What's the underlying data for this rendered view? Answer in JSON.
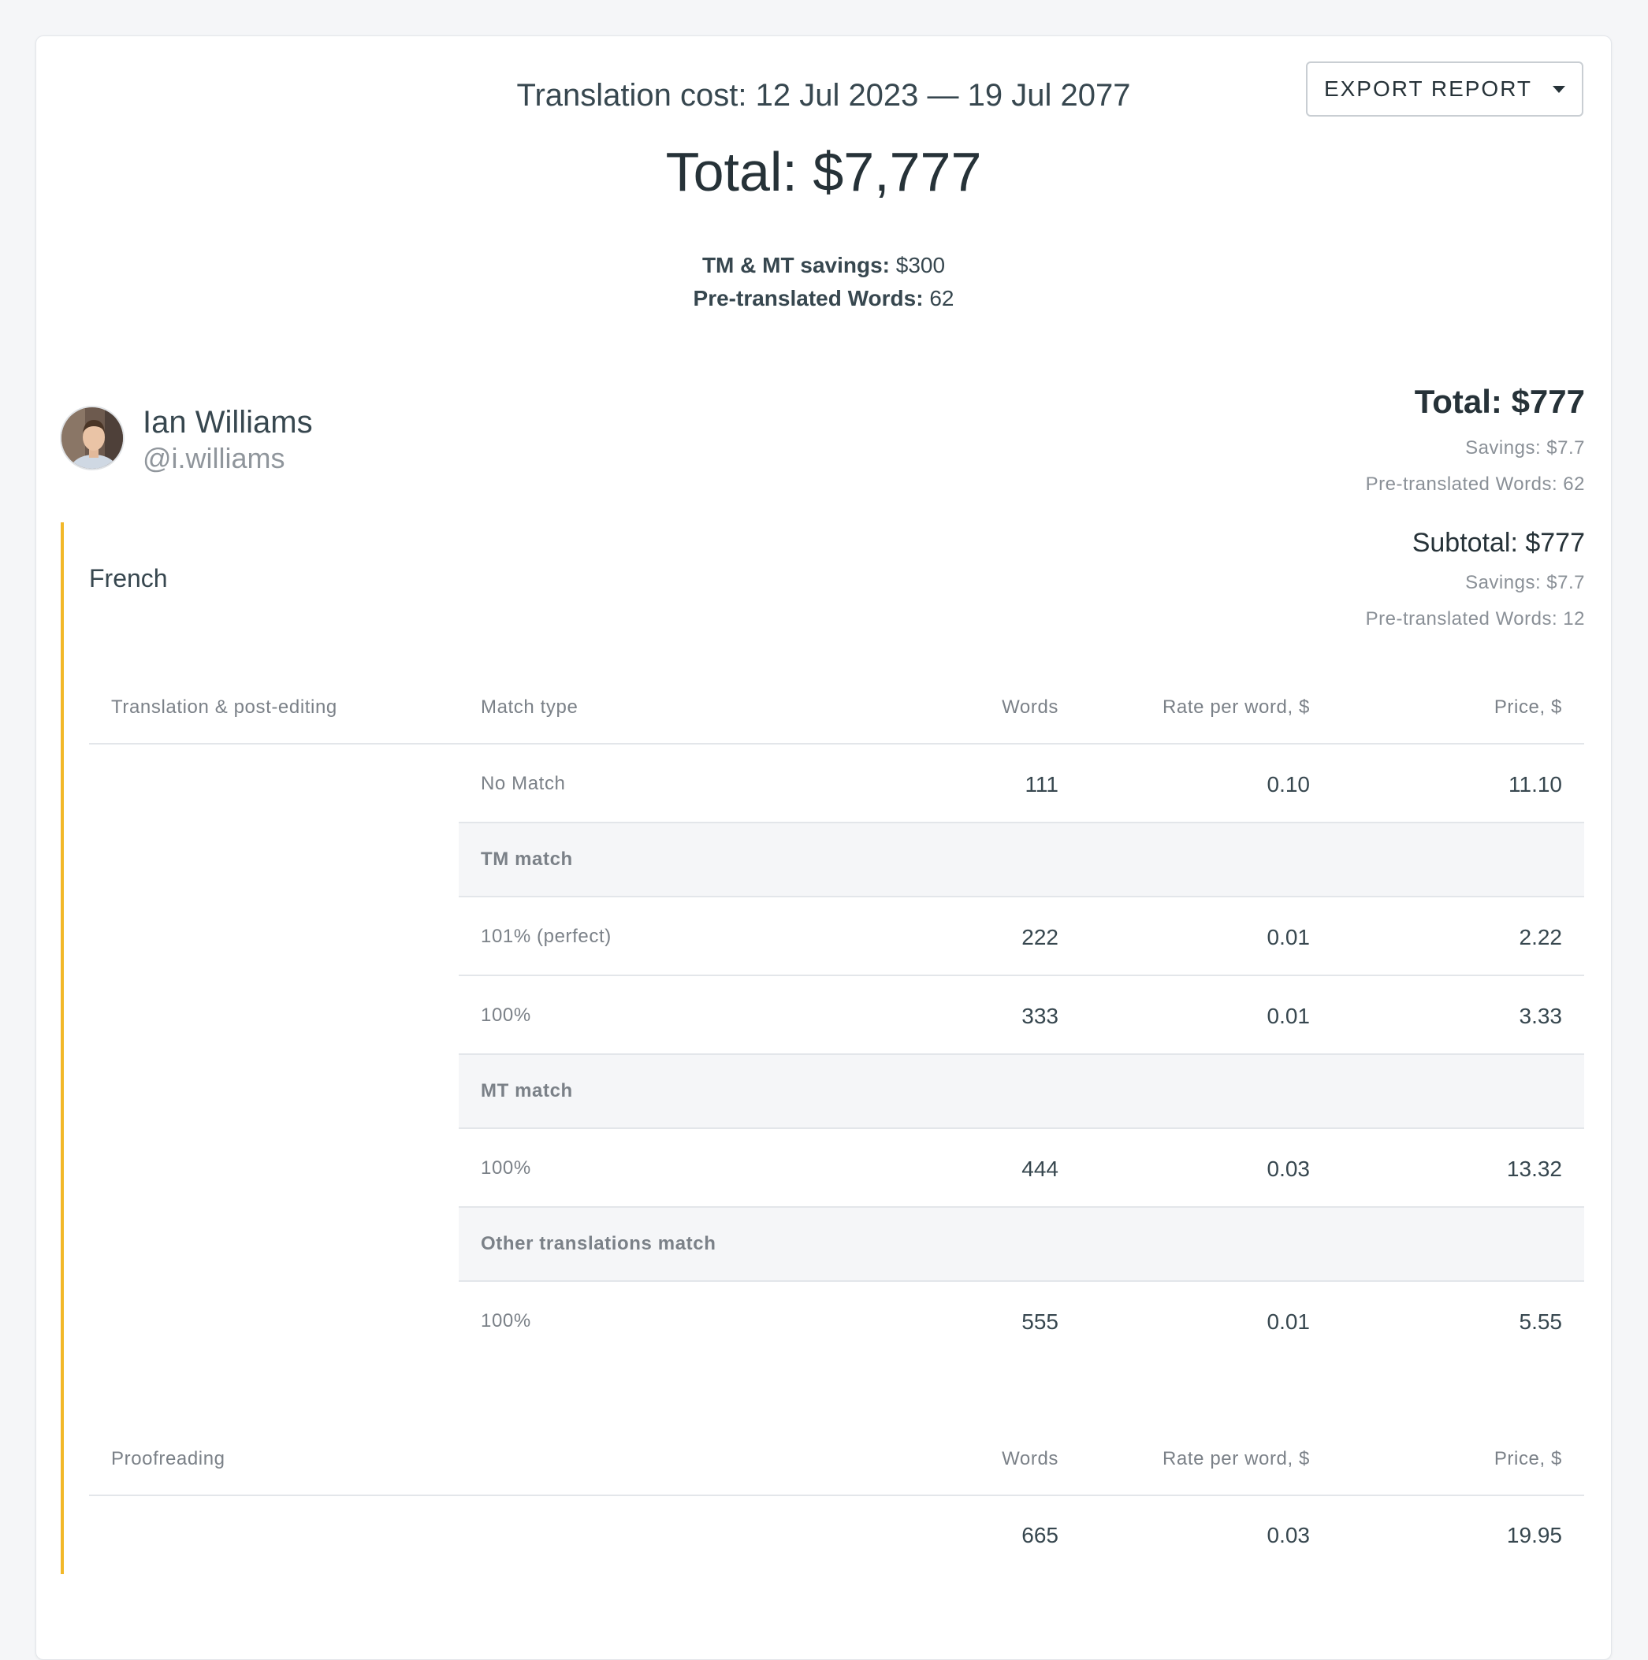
{
  "header": {
    "title": "Translation cost: 12 Jul 2023 — 19 Jul 2077",
    "total": "Total: $7,777",
    "savings_label": "TM & MT savings:",
    "savings_value": "$300",
    "pretranslated_label": "Pre-translated Words:",
    "pretranslated_value": "62",
    "export_label": "EXPORT REPORT"
  },
  "user": {
    "name": "Ian Williams",
    "handle": "@i.williams",
    "total": "Total: $777",
    "savings": "Savings: $7.7",
    "pretranslated": "Pre-translated Words: 62"
  },
  "language": {
    "name": "French",
    "subtotal": "Subtotal: $777",
    "savings": "Savings: $7.7",
    "pretranslated": "Pre-translated Words: 12"
  },
  "translation_table": {
    "headers": {
      "section": "Translation & post-editing",
      "match_type": "Match type",
      "words": "Words",
      "rate": "Rate per word, $",
      "price": "Price, $"
    },
    "rows": [
      {
        "kind": "row",
        "label": "No Match",
        "words": "111",
        "rate": "0.10",
        "price": "11.10"
      },
      {
        "kind": "group",
        "label": "TM match"
      },
      {
        "kind": "row",
        "label": "101% (perfect)",
        "words": "222",
        "rate": "0.01",
        "price": "2.22"
      },
      {
        "kind": "row",
        "label": "100%",
        "words": "333",
        "rate": "0.01",
        "price": "3.33"
      },
      {
        "kind": "group",
        "label": "MT match"
      },
      {
        "kind": "row",
        "label": "100%",
        "words": "444",
        "rate": "0.03",
        "price": "13.32"
      },
      {
        "kind": "group",
        "label": "Other translations match"
      },
      {
        "kind": "row",
        "label": "100%",
        "words": "555",
        "rate": "0.01",
        "price": "5.55"
      }
    ]
  },
  "proofreading_table": {
    "headers": {
      "section": "Proofreading",
      "words": "Words",
      "rate": "Rate per word, $",
      "price": "Price, $"
    },
    "row": {
      "words": "665",
      "rate": "0.03",
      "price": "19.95"
    }
  },
  "colors": {
    "accent": "#f2b829",
    "background": "#f5f6f8",
    "text": "#263238"
  }
}
